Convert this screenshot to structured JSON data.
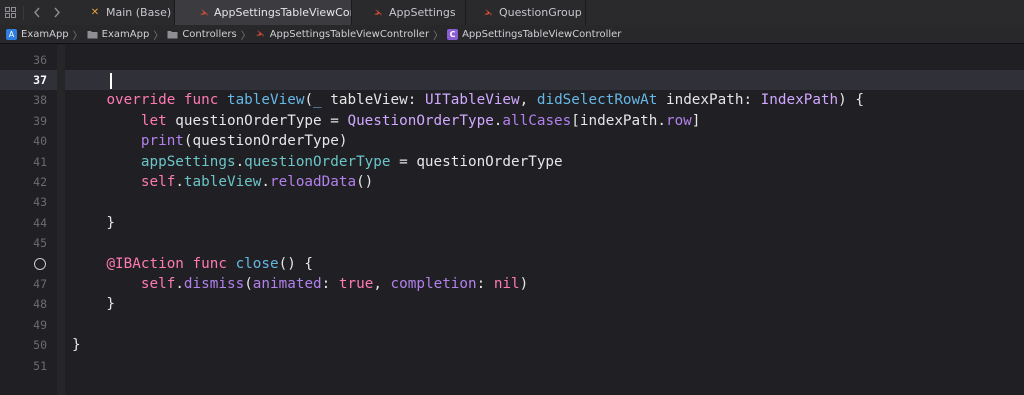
{
  "tabs": [
    {
      "label": "Main (Base)",
      "icon": "xib-icon",
      "active": false
    },
    {
      "label": "AppSettingsTableViewController",
      "icon": "swift-icon",
      "active": true
    },
    {
      "label": "AppSettings",
      "icon": "swift-icon",
      "active": false
    },
    {
      "label": "QuestionGroup",
      "icon": "swift-icon",
      "active": false
    }
  ],
  "jumpbar": {
    "project": "ExamApp",
    "group": "ExamApp",
    "folder": "Controllers",
    "file": "AppSettingsTableViewController",
    "symbol": "AppSettingsTableViewController",
    "symbol_badge": "C"
  },
  "editor": {
    "current_line": 37,
    "line_numbers": [
      "36",
      "37",
      "38",
      "39",
      "40",
      "41",
      "42",
      "43",
      "44",
      "45",
      "",
      "47",
      "48",
      "49",
      "50",
      "51"
    ],
    "breakpoint_line_index": 10,
    "code": [
      [],
      [],
      [
        {
          "t": "    ",
          "c": "plain"
        },
        {
          "t": "override",
          "c": "kw"
        },
        {
          "t": " ",
          "c": "plain"
        },
        {
          "t": "func",
          "c": "kw"
        },
        {
          "t": " ",
          "c": "plain"
        },
        {
          "t": "tableView",
          "c": "fn"
        },
        {
          "t": "(",
          "c": "plain"
        },
        {
          "t": "_",
          "c": "fn"
        },
        {
          "t": " tableView: ",
          "c": "plain"
        },
        {
          "t": "UITableView",
          "c": "ty"
        },
        {
          "t": ", ",
          "c": "plain"
        },
        {
          "t": "didSelectRowAt",
          "c": "fn"
        },
        {
          "t": " indexPath: ",
          "c": "plain"
        },
        {
          "t": "IndexPath",
          "c": "ty"
        },
        {
          "t": ") {",
          "c": "plain"
        }
      ],
      [
        {
          "t": "        ",
          "c": "plain"
        },
        {
          "t": "let",
          "c": "kw"
        },
        {
          "t": " questionOrderType = ",
          "c": "plain"
        },
        {
          "t": "QuestionOrderType",
          "c": "ty"
        },
        {
          "t": ".",
          "c": "plain"
        },
        {
          "t": "allCases",
          "c": "pr"
        },
        {
          "t": "[indexPath.",
          "c": "plain"
        },
        {
          "t": "row",
          "c": "pr"
        },
        {
          "t": "]",
          "c": "plain"
        }
      ],
      [
        {
          "t": "        ",
          "c": "plain"
        },
        {
          "t": "print",
          "c": "pr"
        },
        {
          "t": "(questionOrderType)",
          "c": "plain"
        }
      ],
      [
        {
          "t": "        ",
          "c": "plain"
        },
        {
          "t": "appSettings",
          "c": "prop"
        },
        {
          "t": ".",
          "c": "plain"
        },
        {
          "t": "questionOrderType",
          "c": "prop"
        },
        {
          "t": " = questionOrderType",
          "c": "plain"
        }
      ],
      [
        {
          "t": "        ",
          "c": "plain"
        },
        {
          "t": "self",
          "c": "kw"
        },
        {
          "t": ".",
          "c": "plain"
        },
        {
          "t": "tableView",
          "c": "prop"
        },
        {
          "t": ".",
          "c": "plain"
        },
        {
          "t": "reloadData",
          "c": "pr"
        },
        {
          "t": "()",
          "c": "plain"
        }
      ],
      [],
      [
        {
          "t": "    }",
          "c": "plain"
        }
      ],
      [],
      [
        {
          "t": "    ",
          "c": "plain"
        },
        {
          "t": "@IBAction",
          "c": "attr"
        },
        {
          "t": " ",
          "c": "plain"
        },
        {
          "t": "func",
          "c": "kw"
        },
        {
          "t": " ",
          "c": "plain"
        },
        {
          "t": "close",
          "c": "fn"
        },
        {
          "t": "() {",
          "c": "plain"
        }
      ],
      [
        {
          "t": "        ",
          "c": "plain"
        },
        {
          "t": "self",
          "c": "kw"
        },
        {
          "t": ".",
          "c": "plain"
        },
        {
          "t": "dismiss",
          "c": "pr"
        },
        {
          "t": "(",
          "c": "plain"
        },
        {
          "t": "animated",
          "c": "pr"
        },
        {
          "t": ": ",
          "c": "plain"
        },
        {
          "t": "true",
          "c": "kw"
        },
        {
          "t": ", ",
          "c": "plain"
        },
        {
          "t": "completion",
          "c": "pr"
        },
        {
          "t": ": ",
          "c": "plain"
        },
        {
          "t": "nil",
          "c": "kw"
        },
        {
          "t": ")",
          "c": "plain"
        }
      ],
      [
        {
          "t": "    }",
          "c": "plain"
        }
      ],
      [],
      [
        {
          "t": "}",
          "c": "plain"
        }
      ],
      []
    ]
  }
}
